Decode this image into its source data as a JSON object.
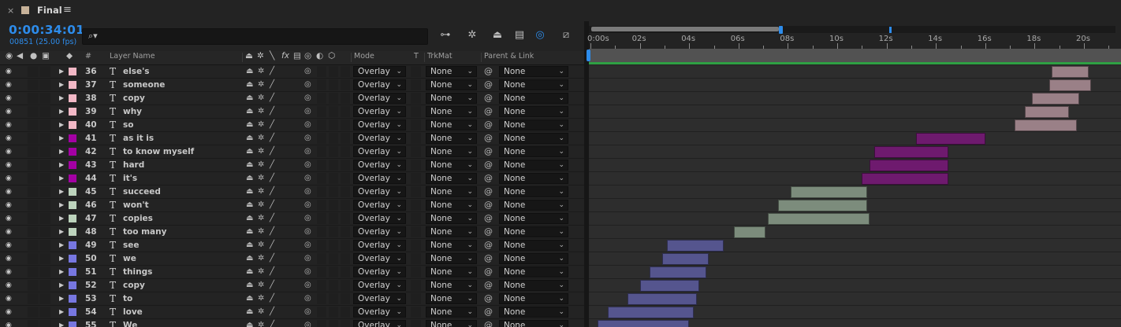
{
  "tab": {
    "close": "×",
    "name": "Final",
    "menu": "≡",
    "swatch_color": "#c7b299"
  },
  "header": {
    "timecode": "0:00:34:01",
    "frames": "00851 (25.00 fps)",
    "search_placeholder": "",
    "search_icon": "search-icon"
  },
  "toolbar_icons": [
    "comp-mini-flowchart-icon",
    "draft-3d-icon",
    "shy-layers-icon",
    "frame-blending-icon",
    "motion-blur-icon",
    "graph-editor-icon"
  ],
  "columns": {
    "num": "#",
    "layer_name": "Layer Name",
    "mode": "Mode",
    "t": "T",
    "trkmat": "TrkMat",
    "parent": "Parent & Link",
    "fx": "fx"
  },
  "ruler": {
    "labels": [
      "0:00s",
      "02s",
      "04s",
      "06s",
      "08s",
      "10s",
      "12s",
      "14s",
      "16s",
      "18s",
      "20s"
    ],
    "range_seconds": [
      0,
      21.5
    ],
    "current_time_seconds": 7.7,
    "marker_seconds": 12.1
  },
  "layers": [
    {
      "num": "36",
      "name": "else's",
      "color": "#f2b8c6",
      "mode": "Overlay",
      "trkmat": "None",
      "parent": "None",
      "in": 18.7,
      "out": 20.2
    },
    {
      "num": "37",
      "name": "someone",
      "color": "#f2b8c6",
      "mode": "Overlay",
      "trkmat": "None",
      "parent": "None",
      "in": 18.6,
      "out": 20.3
    },
    {
      "num": "38",
      "name": "copy",
      "color": "#f2b8c6",
      "mode": "Overlay",
      "trkmat": "None",
      "parent": "None",
      "in": 17.9,
      "out": 19.8
    },
    {
      "num": "39",
      "name": "why",
      "color": "#f2b8c6",
      "mode": "Overlay",
      "trkmat": "None",
      "parent": "None",
      "in": 17.6,
      "out": 19.4
    },
    {
      "num": "40",
      "name": "so",
      "color": "#f2b8c6",
      "mode": "Overlay",
      "trkmat": "None",
      "parent": "None",
      "in": 17.2,
      "out": 19.7
    },
    {
      "num": "41",
      "name": "as it is",
      "color": "#a400a4",
      "mode": "Overlay",
      "trkmat": "None",
      "parent": "None",
      "in": 13.2,
      "out": 16.0
    },
    {
      "num": "42",
      "name": "to know myself",
      "color": "#a400a4",
      "mode": "Overlay",
      "trkmat": "None",
      "parent": "None",
      "in": 11.5,
      "out": 14.5
    },
    {
      "num": "43",
      "name": "hard",
      "color": "#a400a4",
      "mode": "Overlay",
      "trkmat": "None",
      "parent": "None",
      "in": 11.3,
      "out": 14.5
    },
    {
      "num": "44",
      "name": "it's",
      "color": "#a400a4",
      "mode": "Overlay",
      "trkmat": "None",
      "parent": "None",
      "in": 11.0,
      "out": 14.5
    },
    {
      "num": "45",
      "name": "succeed",
      "color": "#bcd3bc",
      "mode": "Overlay",
      "trkmat": "None",
      "parent": "None",
      "in": 8.1,
      "out": 11.2
    },
    {
      "num": "46",
      "name": "won't",
      "color": "#bcd3bc",
      "mode": "Overlay",
      "trkmat": "None",
      "parent": "None",
      "in": 7.6,
      "out": 11.2
    },
    {
      "num": "47",
      "name": "copies",
      "color": "#bcd3bc",
      "mode": "Overlay",
      "trkmat": "None",
      "parent": "None",
      "in": 7.2,
      "out": 11.3
    },
    {
      "num": "48",
      "name": "too many",
      "color": "#bcd3bc",
      "mode": "Overlay",
      "trkmat": "None",
      "parent": "None",
      "in": 5.8,
      "out": 7.1
    },
    {
      "num": "49",
      "name": "see",
      "color": "#7777e0",
      "mode": "Overlay",
      "trkmat": "None",
      "parent": "None",
      "in": 3.1,
      "out": 5.4
    },
    {
      "num": "50",
      "name": "we",
      "color": "#7777e0",
      "mode": "Overlay",
      "trkmat": "None",
      "parent": "None",
      "in": 2.9,
      "out": 4.8
    },
    {
      "num": "51",
      "name": "things",
      "color": "#7777e0",
      "mode": "Overlay",
      "trkmat": "None",
      "parent": "None",
      "in": 2.4,
      "out": 4.7
    },
    {
      "num": "52",
      "name": "copy",
      "color": "#7777e0",
      "mode": "Overlay",
      "trkmat": "None",
      "parent": "None",
      "in": 2.0,
      "out": 4.4
    },
    {
      "num": "53",
      "name": "to",
      "color": "#7777e0",
      "mode": "Overlay",
      "trkmat": "None",
      "parent": "None",
      "in": 1.5,
      "out": 4.3
    },
    {
      "num": "54",
      "name": "love",
      "color": "#7777e0",
      "mode": "Overlay",
      "trkmat": "None",
      "parent": "None",
      "in": 0.7,
      "out": 4.2
    },
    {
      "num": "55",
      "name": "We",
      "color": "#7777e0",
      "mode": "Overlay",
      "trkmat": "None",
      "parent": "None",
      "in": 0.3,
      "out": 4.0
    }
  ],
  "bar_colors": {
    "#f2b8c6": "#9a8087",
    "#a400a4": "#6e1a6e",
    "#bcd3bc": "#7c8c7c",
    "#7777e0": "#55558e"
  }
}
